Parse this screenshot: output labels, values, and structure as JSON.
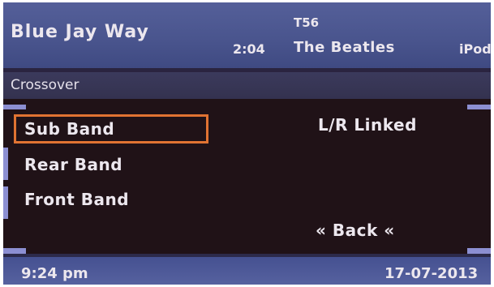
{
  "now_playing": {
    "song_title": "Blue Jay Way",
    "elapsed_time": "2:04",
    "track_number": "T56",
    "artist": "The Beatles",
    "source": "iPod"
  },
  "screen_title": "Crossover",
  "menu": {
    "items": [
      {
        "label": "Sub Band",
        "selected": true
      },
      {
        "label": "Rear Band",
        "selected": false
      },
      {
        "label": "Front Band",
        "selected": false
      }
    ],
    "back_label": "« Back «"
  },
  "status": {
    "linked_label": "L/R Linked"
  },
  "footer": {
    "clock": "9:24 pm",
    "date": "17-07-2013"
  },
  "colors": {
    "header_blue": "#4a558e",
    "body_background": "#201217",
    "selection_outline": "#e17332",
    "tab_accent": "#8c8fd2",
    "text": "#ece7ee"
  }
}
